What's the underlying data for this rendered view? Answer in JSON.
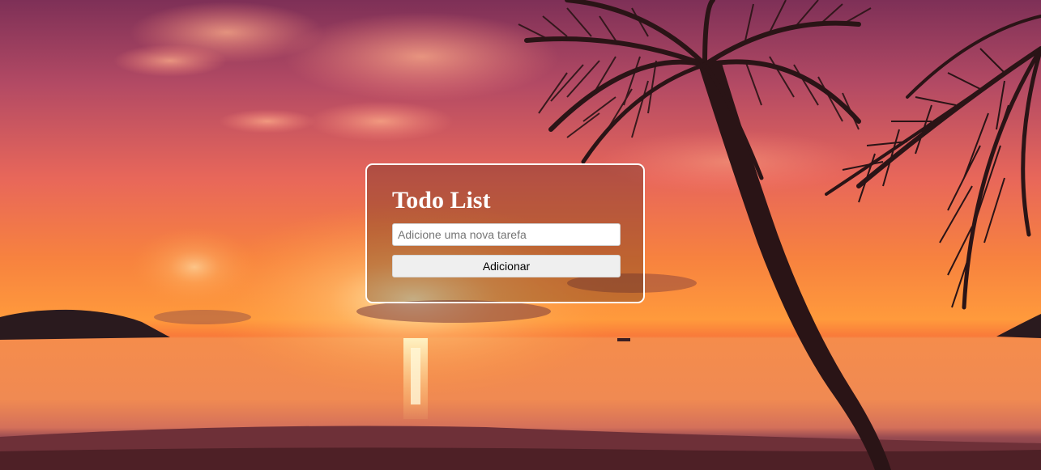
{
  "app": {
    "title": "Todo List"
  },
  "form": {
    "input_value": "",
    "input_placeholder": "Adicione uma nova tarefa",
    "add_button_label": "Adicionar"
  },
  "background": {
    "scene": "tropical-sunset-beach-with-palm-trees",
    "colors": {
      "sky_top": "#8c3a5e",
      "sky_mid": "#e8675a",
      "horizon": "#ff9a3c",
      "sun": "#fff2b0",
      "water": "#f48a4a",
      "sand": "#7a3a3e",
      "silhouette": "#2a1416"
    }
  }
}
